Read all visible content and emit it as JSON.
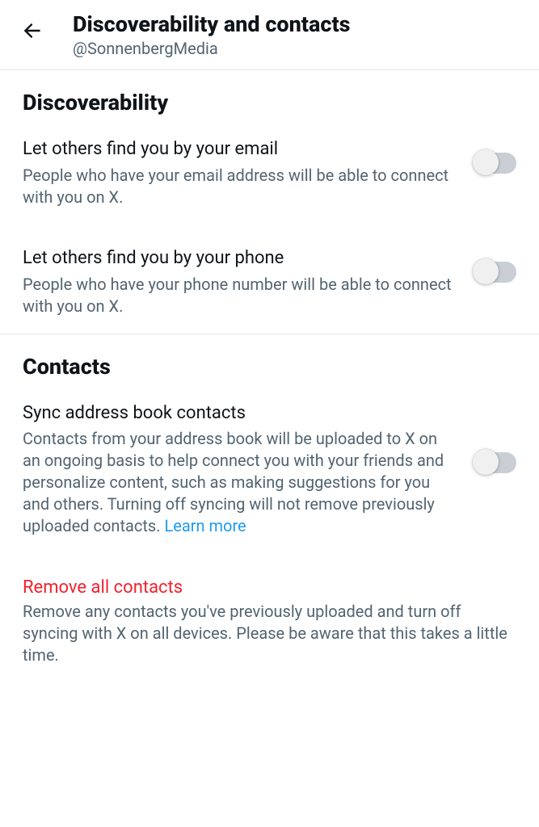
{
  "header": {
    "title": "Discoverability and contacts",
    "username": "@SonnenbergMedia"
  },
  "sections": {
    "discoverability": {
      "title": "Discoverability",
      "settings": {
        "email": {
          "label": "Let others find you by your email",
          "description": "People who have your email address will be able to connect with you on X."
        },
        "phone": {
          "label": "Let others find you by your phone",
          "description": "People who have your phone number will be able to connect with you on X."
        }
      }
    },
    "contacts": {
      "title": "Contacts",
      "settings": {
        "sync": {
          "label": "Sync address book contacts",
          "description": "Contacts from your address book will be uploaded to X on an ongoing basis to help connect you with your friends and personalize content, such as making suggestions for you and others. Turning off syncing will not remove previously uploaded contacts. ",
          "learn_more": "Learn more"
        }
      },
      "remove": {
        "title": "Remove all contacts",
        "description": "Remove any contacts you've previously uploaded and turn off syncing with X on all devices. Please be aware that this takes a little time."
      }
    }
  }
}
